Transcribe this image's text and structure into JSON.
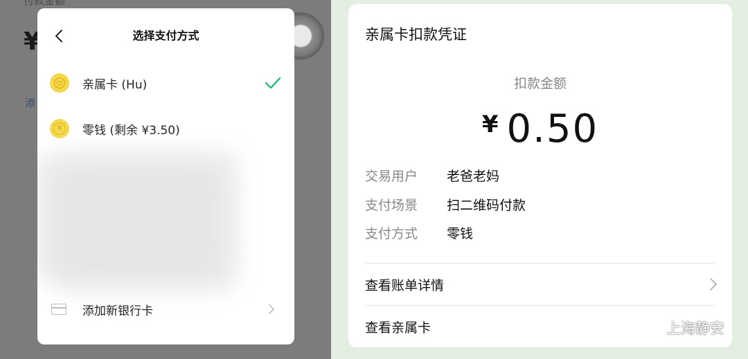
{
  "background_page": {
    "amount_label": "付款金额",
    "currency": "¥",
    "add_text": "添"
  },
  "payment_sheet": {
    "title": "选择支付方式",
    "options": [
      {
        "label": "亲属卡 (Hu)",
        "icon": "family-card-coin-icon",
        "selected": true
      },
      {
        "label": "零钱 (剩余 ¥3.50)",
        "icon": "wallet-coin-icon",
        "coin_glyph": "¥",
        "selected": false
      }
    ],
    "add_card_label": "添加新银行卡"
  },
  "receipt": {
    "title": "亲属卡扣款凭证",
    "amount_label": "扣款金额",
    "currency": "¥",
    "amount": "0.50",
    "details": [
      {
        "key": "交易用户",
        "value": "老爸老妈"
      },
      {
        "key": "支付场景",
        "value": "扫二维码付款"
      },
      {
        "key": "支付方式",
        "value": "零钱"
      }
    ],
    "links": [
      {
        "label": "查看账单详情"
      },
      {
        "label": "查看亲属卡"
      }
    ]
  },
  "watermark": {
    "text": "上海静安",
    "icon": "wechat-official-account-icon"
  },
  "colors": {
    "accent_green": "#07c160",
    "coin_yellow": "#f4d84a",
    "receipt_bg": "#e4eee3"
  }
}
